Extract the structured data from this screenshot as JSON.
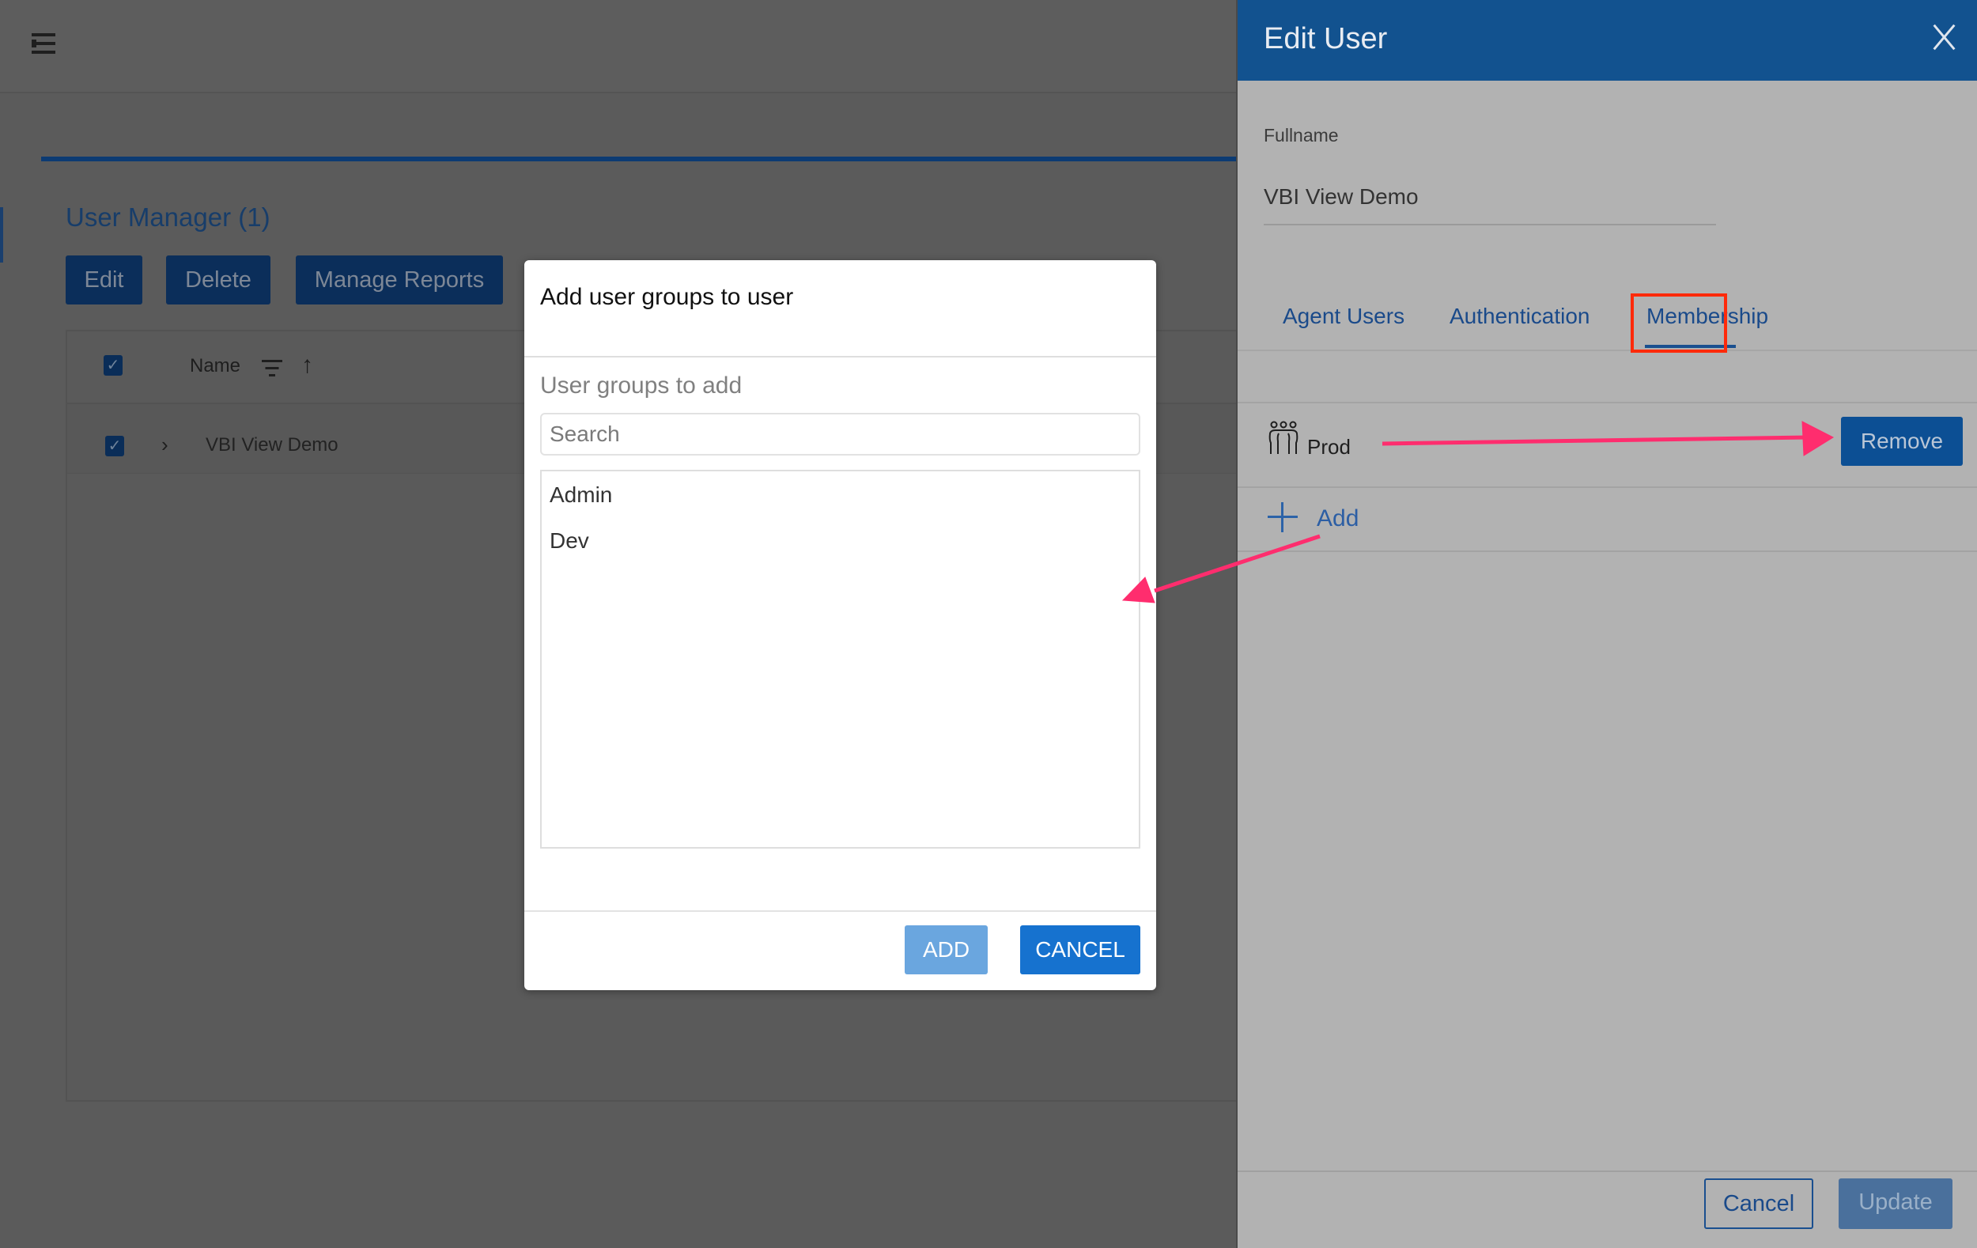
{
  "app": {
    "menu_icon": "hamburger-menu-icon",
    "page_title": "User Manager (1)",
    "toolbar": {
      "edit_label": "Edit",
      "delete_label": "Delete",
      "manage_reports_label": "Manage Reports"
    },
    "table": {
      "columns": [
        {
          "label": "Name",
          "filter_icon": "filter-icon",
          "sort_icon": "sort-ascending-icon",
          "sort_glyph": "↑"
        }
      ],
      "header_checked": true,
      "rows": [
        {
          "name": "VBI View Demo",
          "checked": true,
          "expand_glyph": "›"
        }
      ]
    }
  },
  "dialog": {
    "title": "Add user groups to user",
    "section_label": "User groups to add",
    "search": {
      "placeholder": "Search",
      "value": ""
    },
    "groups": [
      "Admin",
      "Dev"
    ],
    "add_label": "ADD",
    "cancel_label": "CANCEL"
  },
  "panel": {
    "title": "Edit User",
    "close_icon": "close-icon",
    "fullname_label": "Fullname",
    "fullname_value": "VBI View Demo",
    "tabs": [
      {
        "label": "Agent Users",
        "active": false
      },
      {
        "label": "Authentication",
        "active": false
      },
      {
        "label": "Membership",
        "active": true
      }
    ],
    "membership": [
      {
        "name": "Prod",
        "icon": "user-group-icon",
        "remove_label": "Remove"
      }
    ],
    "add_label": "Add",
    "footer": {
      "cancel_label": "Cancel",
      "update_label": "Update"
    }
  },
  "colors": {
    "panel_header": "#12528f",
    "primary_button": "#1672cf",
    "disabled_button": "#6aa6df",
    "annotation_arrow": "#ff2d6e",
    "highlight_box": "#ff2a0a"
  },
  "annotations": {
    "highlight": "Membership tab",
    "arrows": [
      "Prod to Remove",
      "Add to dialog"
    ]
  }
}
